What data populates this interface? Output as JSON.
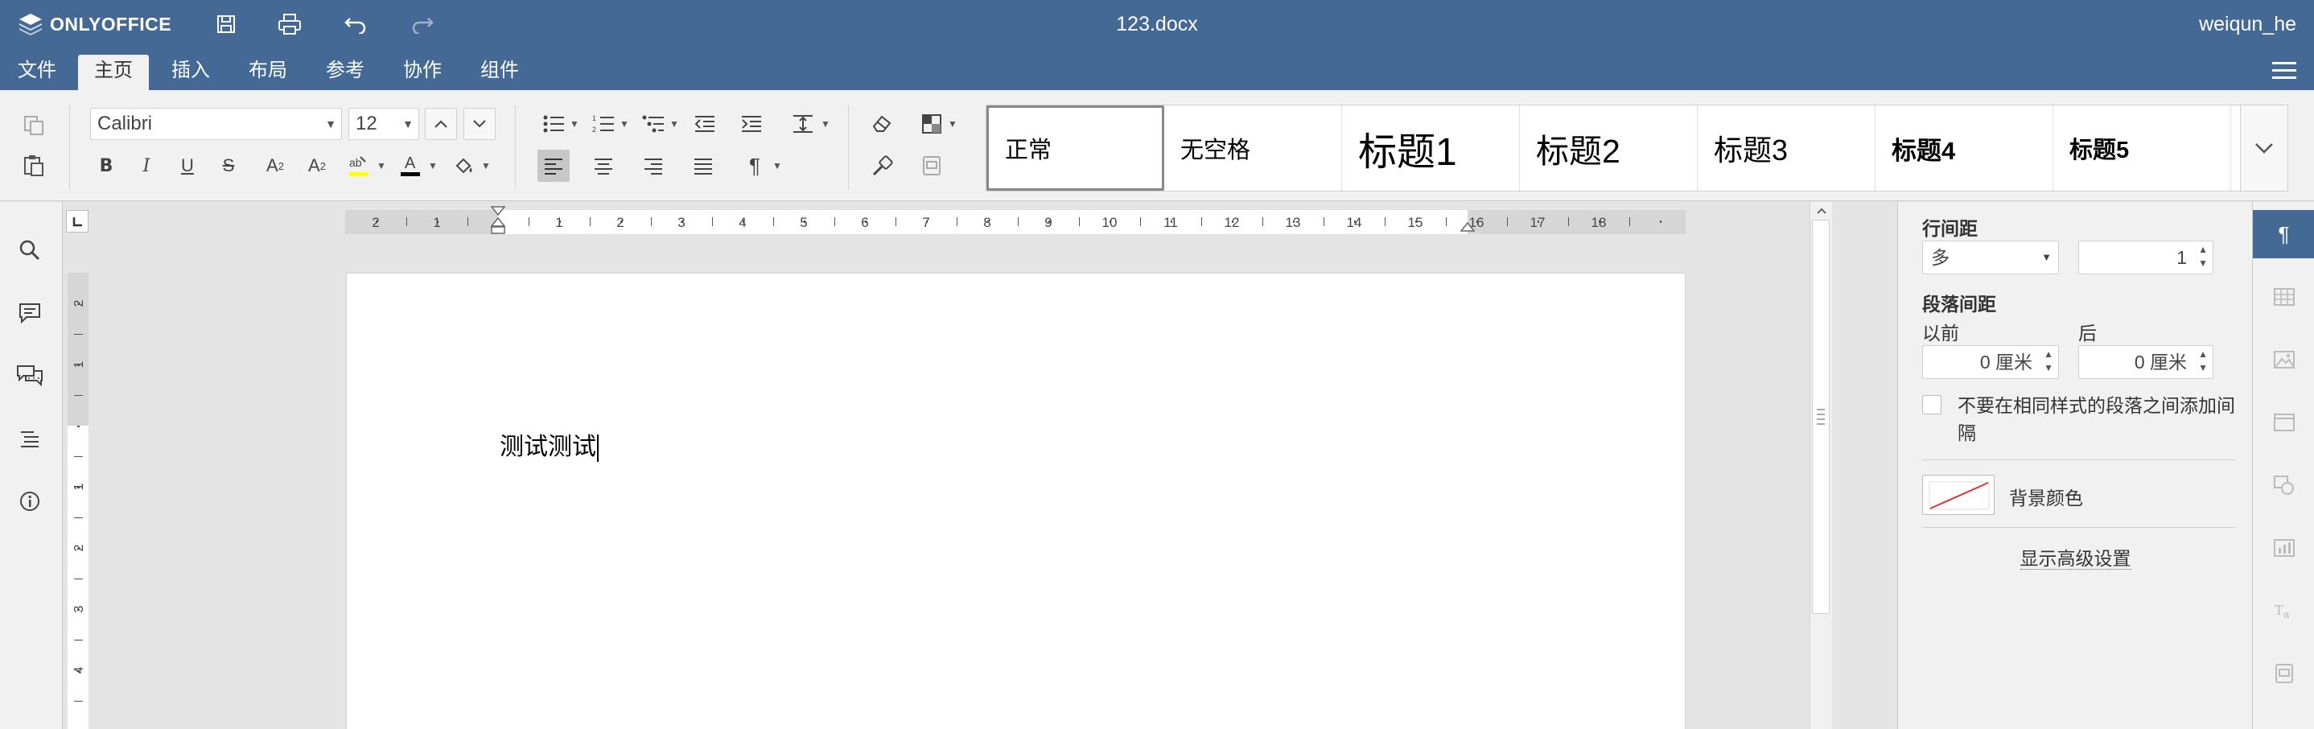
{
  "app": {
    "logo_text": "ONLYOFFICE",
    "doc_title": "123.docx",
    "user": "weiqun_he"
  },
  "menu": {
    "tabs": [
      "文件",
      "主页",
      "插入",
      "布局",
      "参考",
      "协作",
      "组件"
    ],
    "active": "主页"
  },
  "toolbar": {
    "font_name": "Calibri",
    "font_size": "12",
    "styles": [
      "正常",
      "无空格",
      "标题1",
      "标题2",
      "标题3",
      "标题4",
      "标题5"
    ],
    "selected_style": "正常"
  },
  "ruler": {
    "h_labels": [
      "2",
      "1",
      "1",
      "2",
      "3",
      "4",
      "5",
      "6",
      "7",
      "8",
      "9",
      "10",
      "11",
      "12",
      "13",
      "14",
      "15",
      "16",
      "17",
      "18"
    ],
    "v_labels": [
      "2",
      "1",
      "1",
      "1",
      "2",
      "3",
      "4"
    ]
  },
  "document": {
    "text": "测试测试"
  },
  "paragraph_panel": {
    "line_spacing_label": "行间距",
    "line_spacing_mode": "多",
    "line_spacing_value": "1",
    "para_spacing_label": "段落间距",
    "before_label": "以前",
    "after_label": "后",
    "before_value": "0 厘米",
    "after_value": "0 厘米",
    "no_space_checkbox": "不要在相同样式的段落之间添加间隔",
    "no_space_checked": false,
    "background_color_label": "背景颜色",
    "advanced_link": "显示高级设置"
  },
  "colors": {
    "header": "#446995",
    "toolbar_bg": "#f1f1f1",
    "canvas_bg": "#e4e4e4"
  }
}
